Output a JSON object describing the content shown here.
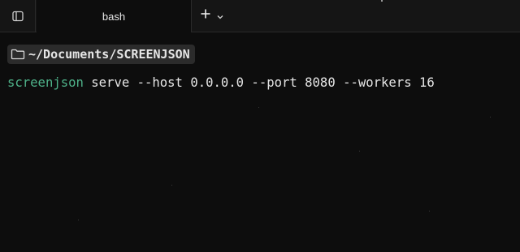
{
  "tabbar": {
    "tabs": [
      {
        "label": "bash",
        "active": true
      }
    ],
    "sidebar_toggle_icon": "sidebar-panel-icon",
    "new_tab_icon": "plus-icon",
    "new_tab_menu_icon": "chevron-down-icon"
  },
  "terminal": {
    "cwd": "~/Documents/SCREENJSON",
    "cwd_icon": "folder-icon",
    "command": {
      "program": "screenjson",
      "args": " serve --host 0.0.0.0 --port 8080 --workers 16"
    }
  },
  "colors": {
    "background": "#0d0d0d",
    "tabbar_background": "#151515",
    "command_green": "#4fb38a",
    "text": "#e6e6e6",
    "chip_background": "#2b2b2b"
  }
}
